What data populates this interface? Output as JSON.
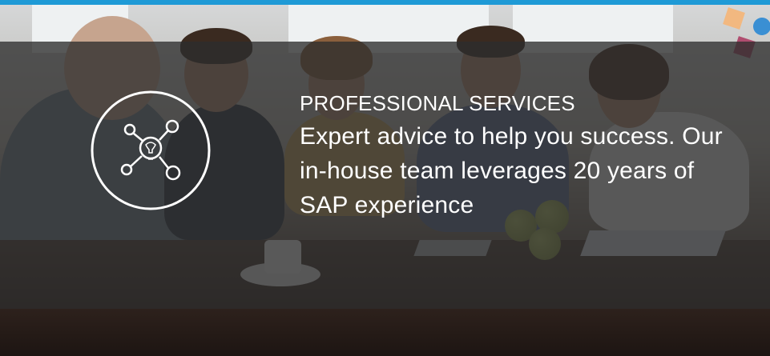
{
  "hero": {
    "kicker": "PROFESSIONAL SERVICES",
    "body": "Expert advice to help you success. Our in-house team leverages 20 years of SAP experience",
    "icon": "lightbulb-network-icon"
  },
  "colors": {
    "accent": "#1e9ad6",
    "overlay": "#2d2d2d",
    "text": "#ffffff"
  }
}
